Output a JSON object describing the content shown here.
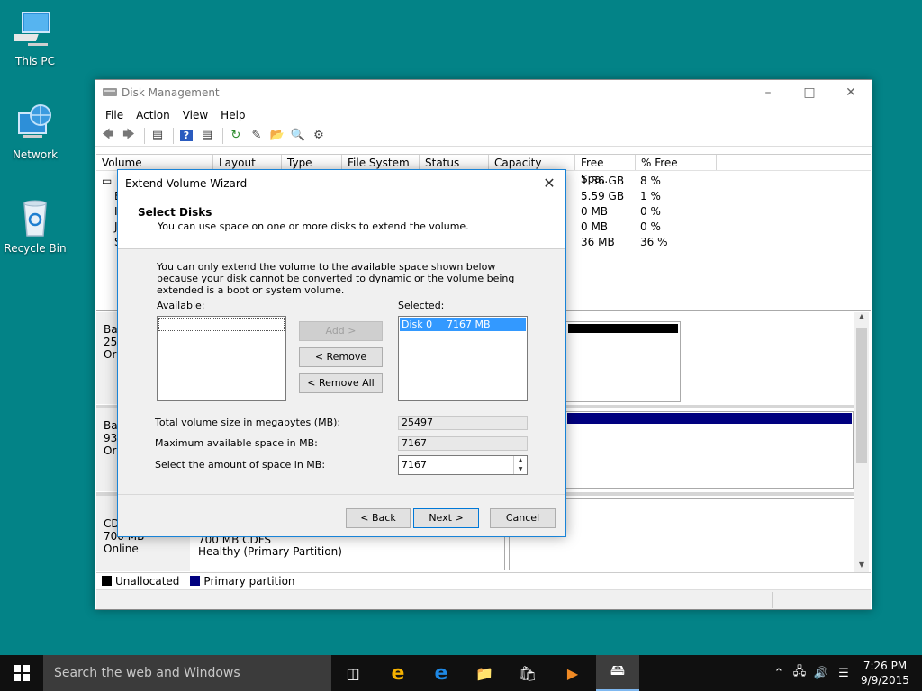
{
  "desktop": {
    "icons": [
      {
        "label": "This PC",
        "icon": "computer-icon"
      },
      {
        "label": "Network",
        "icon": "network-icon"
      },
      {
        "label": "Recycle Bin",
        "icon": "recycle-bin-icon"
      }
    ]
  },
  "window": {
    "title": "Disk Management",
    "menu": [
      "File",
      "Action",
      "View",
      "Help"
    ],
    "columns": [
      "Volume",
      "Layout",
      "Type",
      "File System",
      "Status",
      "Capacity",
      "Free Spa...",
      "% Free"
    ],
    "rows": [
      {
        "vol": "",
        "free": "1.36 GB",
        "pct": "8 %"
      },
      {
        "vol": "E",
        "free": "5.59 GB",
        "pct": "1 %"
      },
      {
        "vol": "I",
        "free": "0 MB",
        "pct": "0 %"
      },
      {
        "vol": "J",
        "free": "0 MB",
        "pct": "0 %"
      },
      {
        "vol": "S",
        "free": "36 MB",
        "pct": "36 %"
      }
    ],
    "disks": [
      {
        "l1": "Ba",
        "l2": "25.",
        "l3": "Or"
      },
      {
        "l1": "Ba",
        "l2": "930",
        "l3": "Or"
      },
      {
        "l1": "CD",
        "l2": "700 MB",
        "l3": "Online",
        "part1": "700 MB CDFS",
        "part2": "Healthy (Primary Partition)"
      }
    ],
    "legend": {
      "unallocated": "Unallocated",
      "primary": "Primary partition",
      "unallocated_color": "#000000",
      "primary_color": "#00007f"
    }
  },
  "dialog": {
    "title": "Extend Volume Wizard",
    "heading": "Select Disks",
    "subheading": "You can use space on one or more disks to extend the volume.",
    "note": "You can only extend the volume to the available space shown below because your disk cannot be converted to dynamic or the volume being extended is a boot or system volume.",
    "available_label": "Available:",
    "selected_label": "Selected:",
    "selected_items": [
      {
        "disk": "Disk 0",
        "size": "7167 MB"
      }
    ],
    "add_btn": "Add >",
    "remove_btn": "< Remove",
    "remove_all_btn": "< Remove All",
    "total_label": "Total volume size in megabytes (MB):",
    "total_value": "25497",
    "max_label": "Maximum available space in MB:",
    "max_value": "7167",
    "select_label": "Select the amount of space in MB:",
    "select_value": "7167",
    "back_btn": "< Back",
    "next_btn": "Next >",
    "cancel_btn": "Cancel"
  },
  "taskbar": {
    "search_placeholder": "Search the web and Windows",
    "time": "7:26 PM",
    "date": "9/9/2015"
  }
}
